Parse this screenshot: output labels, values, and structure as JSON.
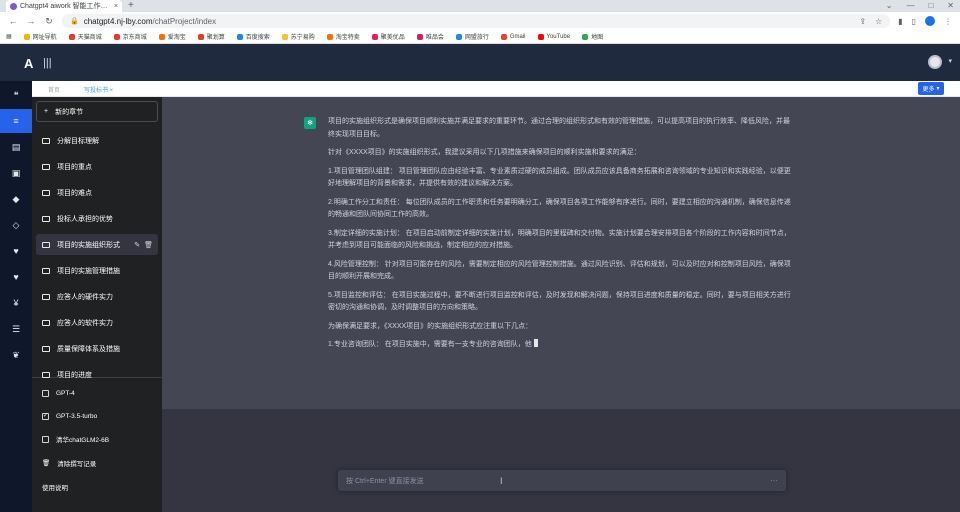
{
  "browser": {
    "tab_title": "Chatgpt4 aiwork 智能工作助手",
    "tab_close": "×",
    "new_tab": "+",
    "window_controls": [
      "⌄",
      "—",
      "□",
      "✕"
    ],
    "url_host": "chatgpt4.nj-lby.com",
    "url_path": "/chatProject/index",
    "bookmarks": [
      {
        "label": "网址导航",
        "color": "#f4b400"
      },
      {
        "label": "天猫商城",
        "color": "#e53935"
      },
      {
        "label": "京东商城",
        "color": "#e53935"
      },
      {
        "label": "爱淘宝",
        "color": "#ff6d00"
      },
      {
        "label": "聚划算",
        "color": "#e53935"
      },
      {
        "label": "百度搜索",
        "color": "#1e88e5"
      },
      {
        "label": "苏宁易购",
        "color": "#fbc02d"
      },
      {
        "label": "淘宝特卖",
        "color": "#ff6d00"
      },
      {
        "label": "聚美优品",
        "color": "#e91e63"
      },
      {
        "label": "唯品会",
        "color": "#d81b60"
      },
      {
        "label": "网盟旅行",
        "color": "#1e88e5"
      },
      {
        "label": "Gmail",
        "color": "#ea4335"
      },
      {
        "label": "YouTube",
        "color": "#ff0000"
      },
      {
        "label": "地图",
        "color": "#34a853"
      }
    ]
  },
  "app": {
    "logo": "A",
    "menu_icon": "|||",
    "subtabs": [
      "首页",
      "写投标书 ×"
    ],
    "more_button": "更多"
  },
  "iconbar": {
    "icons": [
      "chat-bubbles-icon",
      "list-icon",
      "document-icon",
      "document-check-icon",
      "box-icon",
      "box-alt-icon",
      "heart-icon",
      "heart-alt-icon",
      "yen-icon",
      "stack-icon",
      "social-icon"
    ],
    "glyphs": [
      "❝",
      "≡",
      "▤",
      "▣",
      "◆",
      "◇",
      "♥",
      "♥",
      "¥",
      "☰",
      "❦"
    ]
  },
  "sidebar": {
    "new_chapter": "新的章节",
    "new_chapter_icon": "+",
    "items": [
      "分解目标理解",
      "项目的重点",
      "项目的难点",
      "投标人承担的优势",
      "项目的实施组织形式",
      "项目的实施管理措施",
      "应答人的硬件实力",
      "应答人的软件实力",
      "质量保障体系及措施",
      "项目的进度"
    ],
    "active_index": 4,
    "edit_icon": "✎",
    "delete_icon": "🗑",
    "options": [
      {
        "label": "GPT-4",
        "checked": false
      },
      {
        "label": "GPT-3.5-turbo",
        "checked": true
      },
      {
        "label": "清华chatGLM2-6B",
        "checked": false
      }
    ],
    "clear_label": "清除撰写记录",
    "manual_label": "使用说明"
  },
  "answer": {
    "paragraphs": [
      "项目的实施组织形式是确保项目顺利实施并满足要求的重要环节。通过合理的组织形式和有效的管理措施，可以提高项目的执行效率、降低风险，并最终实现项目目标。",
      "针对《XXXX项目》的实施组织形式，我建议采用以下几项措施来确保项目的顺利实施和要求的满足：",
      "1.项目管理团队组建： 项目管理团队应由经验丰富、专业素质过硬的成员组成。团队成员应该具备商务拓展和咨询领域的专业知识和实践经验，以便更好地理解项目的背景和需求，并提供有效的建议和解决方案。",
      "2.明确工作分工和责任： 每位团队成员的工作职责和任务要明确分工，确保项目各项工作能够有序进行。同时，要建立相应的沟通机制，确保信息传递的畅通和团队间协同工作的高效。",
      "3.制定详细的实施计划： 在项目启动前制定详细的实施计划，明确项目的里程碑和交付物。实施计划要合理安排项目各个阶段的工作内容和时间节点，并考虑到项目可能面临的风险和挑战，制定相应的应对措施。",
      "4.风险管理控制： 针对项目可能存在的风险，需要制定相应的风险管理控制措施。通过风险识别、评估和规划，可以及时应对和控制项目风险，确保项目的顺利开展和完成。",
      "5.项目监控和评估： 在项目实施过程中，要不断进行项目监控和评估，及时发现和解决问题，保持项目进度和质量的稳定。同时，要与项目相关方进行密切的沟通和协调，及时调整项目的方向和策略。",
      "为确保满足要求，《XXXX项目》的实施组织形式应注重以下几点：",
      "1.专业咨询团队： 在项目实施中，需要有一支专业的咨询团队，他"
    ]
  },
  "input": {
    "placeholder": "按 Ctrl+Enter 键直接发送",
    "send_icon": "···"
  }
}
